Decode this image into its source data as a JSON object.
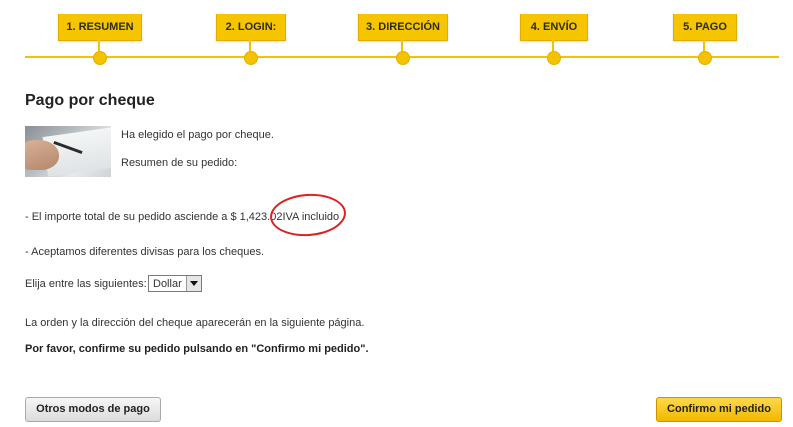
{
  "steps": [
    {
      "label": "1. RESUMEN"
    },
    {
      "label": "2. LOGIN:"
    },
    {
      "label": "3. DIRECCIÓN"
    },
    {
      "label": "4. ENVÍO"
    },
    {
      "label": "5. PAGO"
    }
  ],
  "title": "Pago por cheque",
  "intro": "Ha elegido el pago por cheque.",
  "summary_heading": "Resumen de su pedido:",
  "total_text": "- El importe total de su pedido asciende a $ 1,423.02",
  "tax_note": "IVA incluido",
  "currencies_note": "- Aceptamos diferentes divisas para los cheques.",
  "currency_label": "Elija entre las siguientes:",
  "currency_selected": "Dollar",
  "address_note": "La orden y la dirección del cheque aparecerán en la siguiente página.",
  "confirm_note": "Por favor, confirme su pedido pulsando en \"Confirmo mi pedido\".",
  "buttons": {
    "other": "Otros modos de pago",
    "confirm": "Confirmo mi pedido"
  },
  "colors": {
    "accent": "#f7c400",
    "annotation": "#dd2222"
  }
}
